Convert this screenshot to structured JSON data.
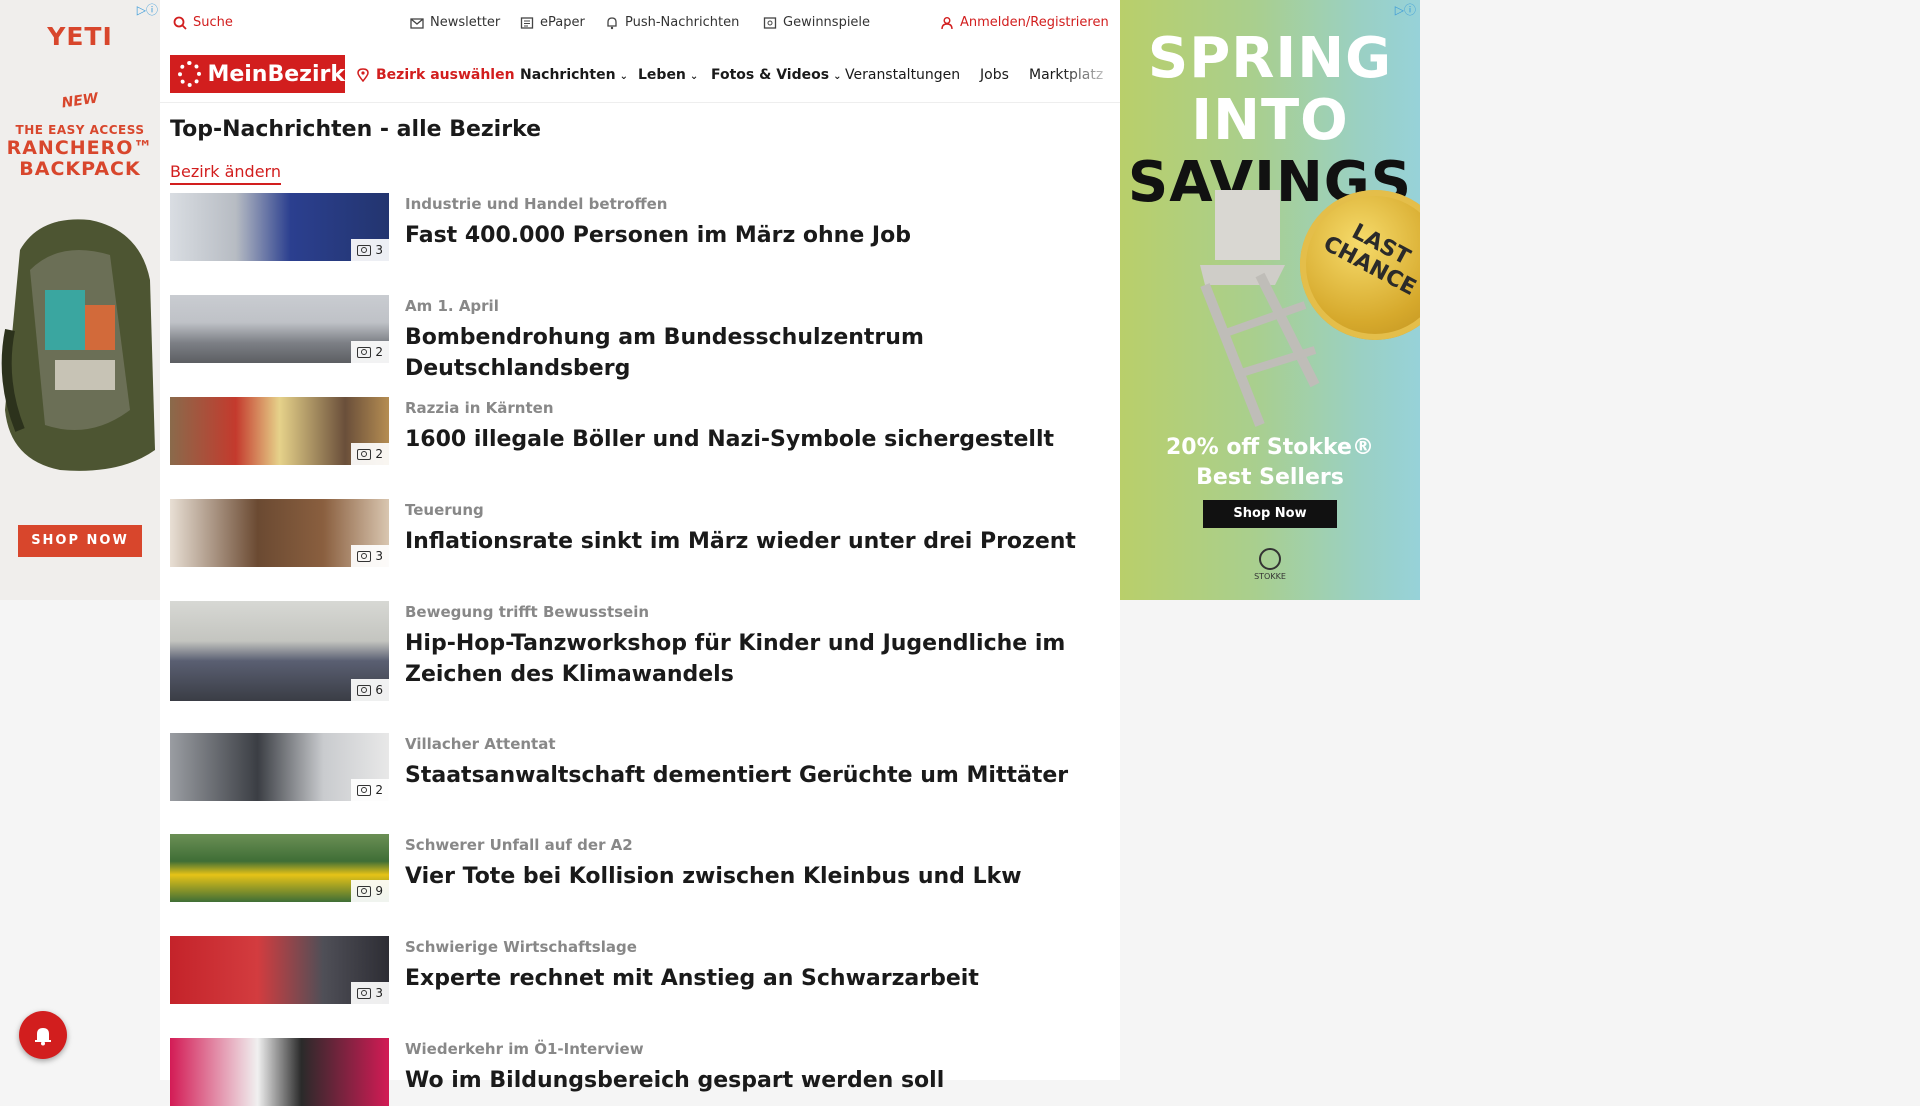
{
  "ad_left": {
    "adchoice": "▷ⓘ",
    "brand": "YETI",
    "new_label": "NEW",
    "line1": "THE EASY ACCESS",
    "line2": "RANCHERO™",
    "line3": "BACKPACK",
    "cta": "SHOP NOW"
  },
  "ad_right": {
    "adchoice": "▷ⓘ",
    "line1": "SPRING",
    "line2": "INTO",
    "line3": "SAVINGS",
    "seal": "LAST CHANCE",
    "offer_line1": "20% off Stokke®",
    "offer_line2": "Best Sellers",
    "cta": "Shop Now",
    "logo_text": "STOKKE"
  },
  "topbar": {
    "search": "Suche",
    "newsletter": "Newsletter",
    "epaper": "ePaper",
    "push": "Push-Nachrichten",
    "gewinnspiele": "Gewinnspiele",
    "login": "Anmelden/Registrieren"
  },
  "nav": {
    "logo": "MeinBezirk",
    "bezirk": "Bezirk auswählen",
    "nachrichten": "Nachrichten",
    "leben": "Leben",
    "fotos": "Fotos & Videos",
    "veranstaltungen": "Veranstaltungen",
    "jobs": "Jobs",
    "marktplatz": "Marktplatz"
  },
  "page": {
    "title": "Top-Nachrichten - alle Bezirke",
    "change_link": "Bezirk ändern"
  },
  "articles": [
    {
      "kicker": "Industrie und Handel betroffen",
      "title": "Fast 400.000 Personen im März ohne Job",
      "images": "3"
    },
    {
      "kicker": "Am 1. April",
      "title": "Bombendrohung am Bundesschulzentrum Deutschlandsberg",
      "images": "2"
    },
    {
      "kicker": "Razzia in Kärnten",
      "title": "1600 illegale Böller und Nazi-Symbole sichergestellt",
      "images": "2"
    },
    {
      "kicker": "Teuerung",
      "title": "Inflationsrate sinkt im März wieder unter drei Prozent",
      "images": "3"
    },
    {
      "kicker": "Bewegung trifft Bewusstsein",
      "title": "Hip-Hop-Tanzworkshop für Kinder und Jugendliche im Zeichen des Klimawandels",
      "images": "6"
    },
    {
      "kicker": "Villacher Attentat",
      "title": "Staatsanwaltschaft dementiert Gerüchte um Mittäter",
      "images": "2"
    },
    {
      "kicker": "Schwerer Unfall auf der A2",
      "title": "Vier Tote bei Kollision zwischen Kleinbus und Lkw",
      "images": "9"
    },
    {
      "kicker": "Schwierige Wirtschaftslage",
      "title": "Experte rechnet mit Anstieg an Schwarzarbeit",
      "images": "3"
    },
    {
      "kicker": "Wiederkehr im Ö1-Interview",
      "title": "Wo im Bildungsbereich gespart werden soll",
      "images": ""
    }
  ]
}
